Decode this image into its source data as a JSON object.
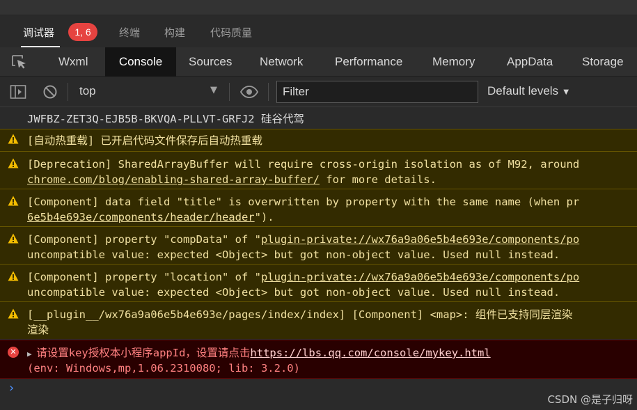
{
  "top_tabs": {
    "debugger": "调试器",
    "badge": "1, 6",
    "terminal": "终端",
    "build": "构建",
    "code_quality": "代码质量"
  },
  "panel_tabs": {
    "wxml": "Wxml",
    "console": "Console",
    "sources": "Sources",
    "network": "Network",
    "performance": "Performance",
    "memory": "Memory",
    "appdata": "AppData",
    "storage": "Storage"
  },
  "toolbar": {
    "context": "top",
    "filter_placeholder": "Filter",
    "levels": "Default levels"
  },
  "messages": [
    {
      "level": "info",
      "lines": [
        "JWFBZ-ZET3Q-EJB5B-BKVQA-PLLVT-GRFJ2 硅谷代驾"
      ]
    },
    {
      "level": "warning",
      "lines": [
        "[自动热重载] 已开启代码文件保存后自动热重载"
      ]
    },
    {
      "level": "warning",
      "lines": [
        "[Deprecation] SharedArrayBuffer will require cross-origin isolation as of M92, around"
      ],
      "link": "chrome.com/blog/enabling-shared-array-buffer/",
      "link_suffix": " for more details."
    },
    {
      "level": "warning",
      "lines": [
        "[Component] data field \"title\" is overwritten by property with the same name (when pr"
      ],
      "link": "6e5b4e693e/components/header/header",
      "link_suffix": "\")."
    },
    {
      "level": "warning",
      "prefix": "[Component] property \"compData\" of \"",
      "link": "plugin-private://wx76a9a06e5b4e693e/components/po",
      "line2": "uncompatible value: expected <Object> but got non-object value. Used null instead."
    },
    {
      "level": "warning",
      "prefix": "[Component] property \"location\" of \"",
      "link": "plugin-private://wx76a9a06e5b4e693e/components/po",
      "line2": "uncompatible value: expected <Object> but got non-object value. Used null instead."
    },
    {
      "level": "warning",
      "lines": [
        "[__plugin__/wx76a9a06e5b4e693e/pages/index/index] [Component] <map>: 组件已支持同层渲染",
        "渲染"
      ]
    },
    {
      "level": "error",
      "prefix": "请设置key授权本小程序appId，设置请点击",
      "link": "https://lbs.qq.com/console/mykey.html",
      "line2": "(env: Windows,mp,1.06.2310080; lib: 3.2.0)"
    }
  ],
  "prompt_symbol": "›",
  "watermark": "CSDN @是子归呀",
  "colors": {
    "accent_badge": "#e64340",
    "warning_bg": "#332b00",
    "error_bg": "#290000",
    "prompt": "#4d90fe"
  },
  "icons": [
    "inspect-icon",
    "sidebar-toggle-icon",
    "clear-icon",
    "eye-icon",
    "warning-icon",
    "error-icon"
  ]
}
